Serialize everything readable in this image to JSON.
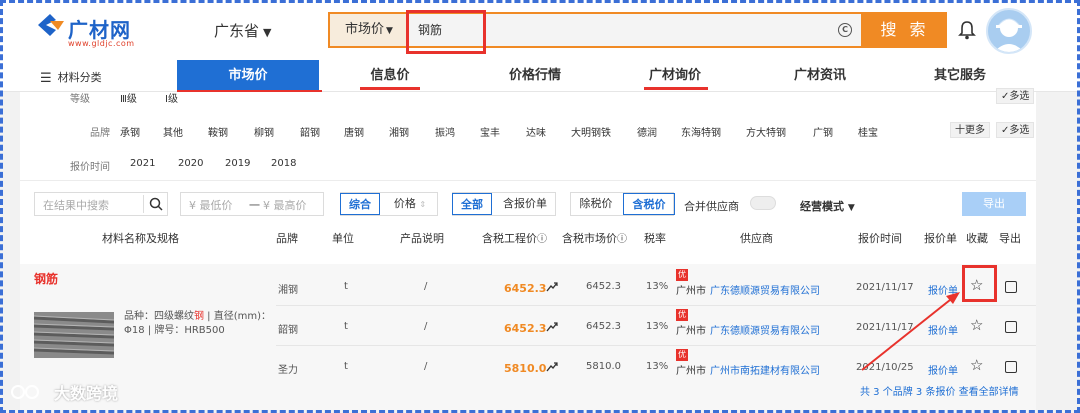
{
  "brand": {
    "name": "广材网",
    "domain": "www.gldjc.com",
    "primary_color": "#1f6fd4",
    "accent_color": "#f08a24",
    "highlight_color": "#e8322c"
  },
  "header": {
    "province": "广东省",
    "search_type": "市场价",
    "search_value": "钢筋",
    "search_button": "搜 索"
  },
  "nav": {
    "category_label": "材料分类",
    "items": [
      {
        "label": "市场价",
        "active": true
      },
      {
        "label": "信息价"
      },
      {
        "label": "价格行情"
      },
      {
        "label": "广材询价"
      },
      {
        "label": "广材资讯"
      },
      {
        "label": "其它服务"
      }
    ]
  },
  "filters": {
    "grade_row": {
      "label": "等级",
      "options": [
        "Ⅲ级",
        "Ⅰ级"
      ],
      "multi": "多选"
    },
    "brand_row": {
      "label": "品牌",
      "options": [
        "承钢",
        "其他",
        "鞍钢",
        "柳钢",
        "韶钢",
        "唐钢",
        "湘钢",
        "振鸿",
        "宝丰",
        "达味",
        "大明钢铁",
        "德润",
        "东海特钢",
        "方大特钢",
        "广钢",
        "桂宝"
      ],
      "more": "十更多",
      "multi": "多选"
    },
    "time_row": {
      "label": "报价时间",
      "options": [
        "2021",
        "2020",
        "2019",
        "2018"
      ]
    }
  },
  "toolbar": {
    "search_placeholder": "在结果中搜索",
    "min_price_placeholder": "¥ 最低价",
    "dash": "一",
    "max_price_placeholder": "¥ 最高价",
    "sort_options": [
      "综合",
      "价格"
    ],
    "filter_all": "全部",
    "filter_quote": "含报价单",
    "tax_excl": "除税价",
    "tax_incl": "含税价",
    "merge_supplier": "合并供应商",
    "mode": "经营模式",
    "export": "导出"
  },
  "table": {
    "headers": [
      "材料名称及规格",
      "品牌",
      "单位",
      "产品说明",
      "含税工程价",
      "含税市场价",
      "税率",
      "供应商",
      "报价时间",
      "报价单",
      "收藏",
      "导出"
    ],
    "product": {
      "name": "钢筋",
      "desc_parts": [
        "品种：四级螺纹",
        "钢",
        " | 直径(mm)：Φ18 | 牌号：HRB500"
      ]
    },
    "rows": [
      {
        "brand": "湘钢",
        "unit": "t",
        "note": "/",
        "eng_price": "6452.3",
        "mkt_price": "6452.3",
        "tax": "13%",
        "badge": "优",
        "supplier_city": "广州市",
        "supplier": "广东德顺源贸易有限公司",
        "date": "2021/11/17",
        "quote": "报价单"
      },
      {
        "brand": "韶钢",
        "unit": "t",
        "note": "/",
        "eng_price": "6452.3",
        "mkt_price": "6452.3",
        "tax": "13%",
        "badge": "优",
        "supplier_city": "广州市",
        "supplier": "广东德顺源贸易有限公司",
        "date": "2021/11/17",
        "quote": "报价单"
      },
      {
        "brand": "圣力",
        "unit": "t",
        "note": "/",
        "eng_price": "5810.0",
        "mkt_price": "5810.0",
        "tax": "13%",
        "badge": "优",
        "supplier_city": "广州市",
        "supplier": "广州市南拓建材有限公司",
        "date": "2021/10/25",
        "quote": "报价单"
      }
    ],
    "summary": "共 3 个品牌 3 条报价 查看全部详情"
  },
  "watermark": "大数跨境",
  "icons": {
    "search": "search-icon",
    "bell": "bell-icon",
    "star": "star-icon",
    "trend": "trend-icon",
    "menu": "menu-icon",
    "copyright": "copyright-icon"
  }
}
